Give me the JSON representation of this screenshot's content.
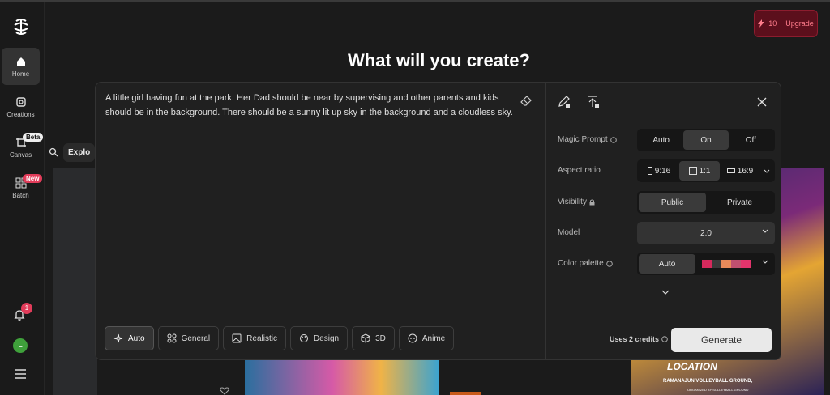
{
  "sidebar": {
    "items": [
      {
        "label": "Home",
        "icon": "home-icon"
      },
      {
        "label": "Creations",
        "icon": "image-icon"
      },
      {
        "label": "Canvas",
        "icon": "crop-icon",
        "badge": "Beta"
      },
      {
        "label": "Batch",
        "icon": "grid-icon",
        "badge": "New"
      }
    ],
    "notifications": "1",
    "avatar": "L"
  },
  "upgrade": {
    "credits": "10",
    "label": "Upgrade"
  },
  "headline": "What will you create?",
  "explore": {
    "label": "Explo"
  },
  "prompt": {
    "text": "A little girl having fun at the park. Her Dad should be near by supervising and other parents and kids should be in the background. There should be a sunny lit up sky in the background and a cloudless sky."
  },
  "styles": [
    {
      "label": "Auto",
      "icon": "sparkle-icon"
    },
    {
      "label": "General",
      "icon": "general-icon"
    },
    {
      "label": "Realistic",
      "icon": "photo-icon"
    },
    {
      "label": "Design",
      "icon": "palette-icon"
    },
    {
      "label": "3D",
      "icon": "cube-icon"
    },
    {
      "label": "Anime",
      "icon": "face-icon"
    }
  ],
  "settings": {
    "magic_prompt": {
      "label": "Magic Prompt",
      "options": [
        "Auto",
        "On",
        "Off"
      ],
      "selected": "On"
    },
    "aspect_ratio": {
      "label": "Aspect ratio",
      "options": [
        "9:16",
        "1:1",
        "16:9"
      ],
      "selected": "1:1"
    },
    "visibility": {
      "label": "Visibility",
      "options": [
        "Public",
        "Private"
      ],
      "selected": "Public"
    },
    "model": {
      "label": "Model",
      "value": "2.0"
    },
    "color_palette": {
      "label": "Color palette",
      "value": "Auto",
      "swatches": [
        "#d6295c",
        "#3a3a3a",
        "#e88a5a",
        "#c05070",
        "#e3346c"
      ]
    }
  },
  "footer": {
    "credits_text": "Uses 2 credits",
    "generate": "Generate"
  },
  "gallery": {
    "location": "LOCATION",
    "venue": "RAMANAJUN VOLLEYBALL GROUND,",
    "organizer": "ORGANIZED BY SOLLEYBALL GROUND"
  }
}
